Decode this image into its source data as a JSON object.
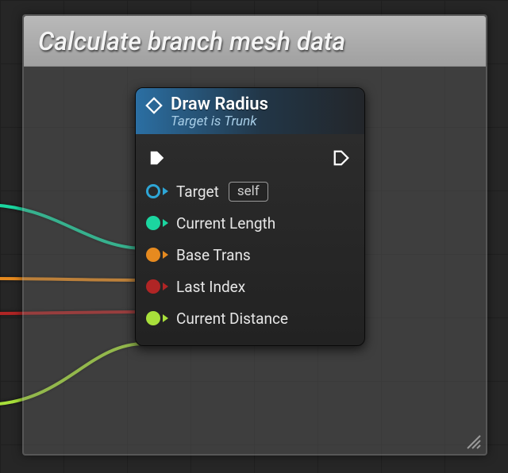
{
  "comment": {
    "title": "Calculate branch mesh data"
  },
  "node": {
    "title": "Draw Radius",
    "subtitle": "Target is Trunk",
    "inputs": {
      "target": {
        "label": "Target",
        "default": "self",
        "icon": "object-pin-icon",
        "color": "#2ea6d6",
        "connected": false
      },
      "current_length": {
        "label": "Current Length",
        "icon": "float-pin-icon",
        "color": "#1bd6a0",
        "connected": true
      },
      "base_trans": {
        "label": "Base Trans",
        "icon": "transform-pin-icon",
        "color": "#e68a1f",
        "connected": true
      },
      "last_index": {
        "label": "Last Index",
        "icon": "int-pin-icon",
        "color": "#b02525",
        "connected": true
      },
      "current_distance": {
        "label": "Current Distance",
        "icon": "float-pin-icon",
        "color": "#a8e03b",
        "connected": true
      }
    }
  },
  "colors": {
    "wire_length": "#1bd6a0",
    "wire_trans": "#e68a1f",
    "wire_index": "#b02525",
    "wire_distance": "#a8e03b"
  }
}
